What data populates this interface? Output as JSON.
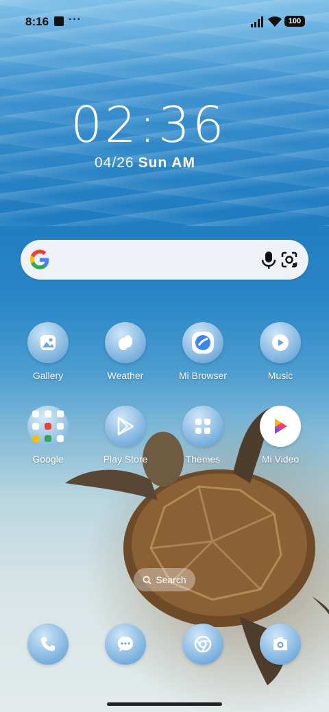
{
  "status": {
    "time": "8:16",
    "more": "···",
    "battery": "100"
  },
  "clock": {
    "time": "02:36",
    "date": "04/26",
    "day": "Sun AM"
  },
  "apps_row1": [
    {
      "label": "Gallery"
    },
    {
      "label": "Weather"
    },
    {
      "label": "Mi Browser"
    },
    {
      "label": "Music"
    }
  ],
  "apps_row2": [
    {
      "label": "Google"
    },
    {
      "label": "Play Store"
    },
    {
      "label": "Themes"
    },
    {
      "label": "Mi Video"
    }
  ],
  "search_pill": {
    "label": "Search"
  },
  "dock": [
    {
      "icon": "phone-icon"
    },
    {
      "icon": "messages-icon"
    },
    {
      "icon": "chrome-icon"
    },
    {
      "icon": "camera-icon"
    }
  ],
  "colors": {
    "icon_glyph": "#ffffff",
    "google_blue": "#4285F4",
    "google_red": "#EA4335",
    "google_yellow": "#FBBC05",
    "google_green": "#34A853"
  }
}
